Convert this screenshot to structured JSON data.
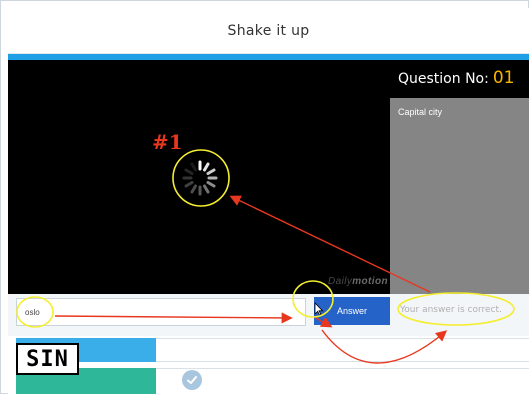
{
  "header": {
    "title": "Shake it up"
  },
  "question": {
    "label": "Question No:",
    "number": "01",
    "text": "Capital city"
  },
  "video": {
    "brand_light": "Daily",
    "brand_bold": "motion"
  },
  "answer": {
    "value": "oslo",
    "button_label": "Answer",
    "result": "Your answer is correct."
  },
  "annotation": {
    "tag": "#1"
  },
  "logo": {
    "text": "SIN"
  },
  "colors": {
    "accent": "#1e9fe6",
    "highlight": "#f7b500",
    "answer_button": "#2563c9",
    "annotation_red": "#e8371f",
    "annotation_yellow": "#f4ee30"
  },
  "icons": {
    "spinner": "loading-spinner-icon",
    "check": "checkmark-icon",
    "cursor": "mouse-pointer-icon"
  }
}
